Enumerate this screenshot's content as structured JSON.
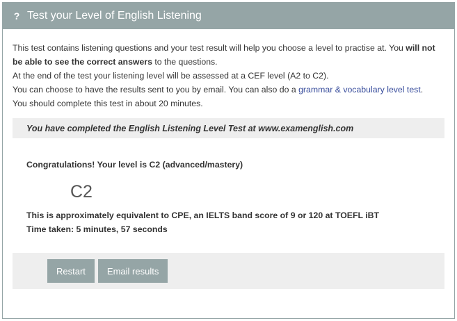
{
  "header": {
    "icon": "question-icon",
    "icon_glyph": "?",
    "title": "Test your Level of English Listening"
  },
  "intro": {
    "p1_a": "This test contains listening questions and your test result will help you choose a level to practise at. You ",
    "p1_bold": "will not be able to see the correct answers",
    "p1_b": " to the questions.",
    "p2": "At the end of the test your listening level will be assessed at a CEF level (A2 to C2).",
    "p3_a": "You can choose to have the results sent to you by email. You can also do a ",
    "p3_link": "grammar & vocabulary level test",
    "p3_b": ".",
    "p4": "You should complete this test in about 20 minutes."
  },
  "completed_message": "You have completed the English Listening Level Test at www.examenglish.com",
  "result": {
    "congrats": "Congratulations! Your level is C2 (advanced/mastery)",
    "level": "C2",
    "equivalent": "This is approximately equivalent to CPE, an IELTS band score of 9 or 120 at TOEFL iBT",
    "time_taken": "Time taken: 5 minutes, 57 seconds"
  },
  "actions": {
    "restart_label": "Restart",
    "email_label": "Email results"
  },
  "colors": {
    "header_bg": "#95a5a6",
    "link": "#34499a",
    "bar_bg": "#eeeeee"
  }
}
